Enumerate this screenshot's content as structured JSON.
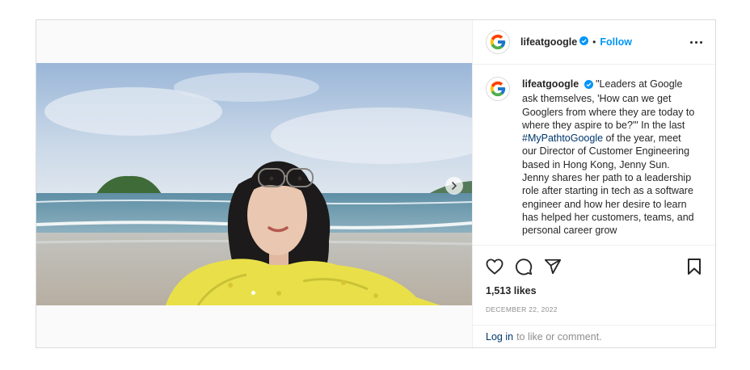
{
  "account": {
    "username": "lifeatgoogle",
    "separator": "•",
    "follow_label": "Follow"
  },
  "caption": {
    "username": "lifeatgoogle",
    "text_before": "\"Leaders at Google ask themselves, 'How can we get Googlers from where they are today to where they aspire to be?'\" In the last ",
    "hashtag": "#MyPathtoGoogle",
    "text_after": " of the year, meet our Director of Customer Engineering based in Hong Kong, Jenny Sun. Jenny shares her path to a leadership role after starting in tech as a software engineer and how her desire to learn has helped her customers, teams, and personal career grow"
  },
  "stats": {
    "likes": "1,513 likes",
    "date": "DECEMBER 22, 2022"
  },
  "comment": {
    "login_label": "Log in",
    "rest": "to like or comment."
  },
  "icons": {
    "like": "heart-icon",
    "comment": "comment-icon",
    "share": "share-icon",
    "save": "bookmark-icon",
    "more": "more-options-icon",
    "verified": "verified-badge-icon",
    "next": "chevron-right-icon"
  },
  "colors": {
    "follow": "#0095f6",
    "hashtag": "#00376b",
    "verified": "#0095f6",
    "muted": "#8e8e8e"
  }
}
